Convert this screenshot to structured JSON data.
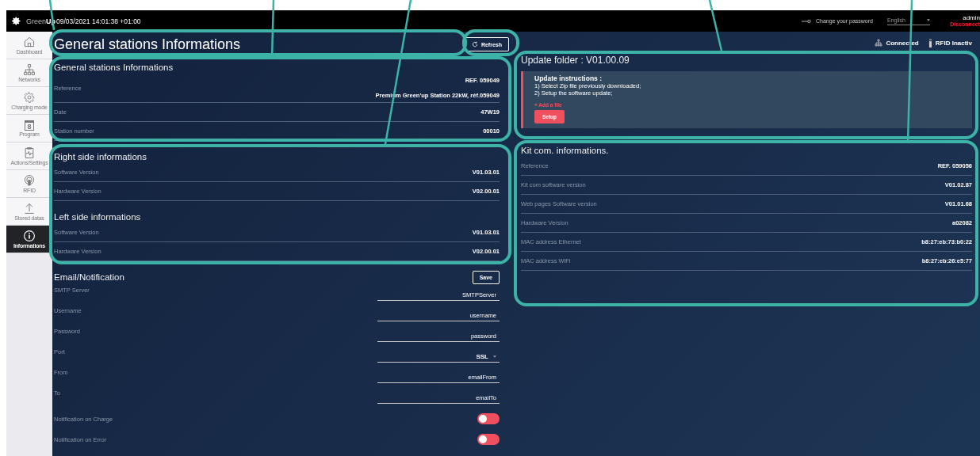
{
  "top_bar": {
    "brand_light": "Green",
    "brand_bold": "Up",
    "datetime": "09/03/2021 14:01:38 +01:00",
    "change_password": "Change your password",
    "language": "English",
    "user": "admin",
    "logout": "Disconnect"
  },
  "sidebar": {
    "items": [
      {
        "label": "Dashboard",
        "selected": false
      },
      {
        "label": "Networks",
        "selected": false
      },
      {
        "label": "Charging mode",
        "selected": false
      },
      {
        "label": "Program",
        "icon_digit": "8",
        "selected": false
      },
      {
        "label": "Actions/Settings",
        "selected": false
      },
      {
        "label": "RFID",
        "selected": false
      },
      {
        "label": "Stored datas",
        "selected": false
      },
      {
        "label": "Informations",
        "selected": true
      }
    ]
  },
  "page": {
    "title": "General stations Informations",
    "refresh_button": "Refresh"
  },
  "status": {
    "connection": "Connected",
    "rfid": "RFID Inactiv"
  },
  "general": {
    "title": "General stations Informations",
    "rows": [
      {
        "label": "Reference",
        "values": [
          "REF. 059049",
          "Premium Green'up Station 22kW, réf.059049"
        ]
      },
      {
        "label": "Date",
        "values": [
          "47W19"
        ]
      },
      {
        "label": "Station number",
        "values": [
          "00010"
        ]
      }
    ]
  },
  "sides": [
    {
      "title": "Right side informations",
      "rows": [
        {
          "label": "Software Version",
          "value": "V01.03.01"
        },
        {
          "label": "Hardware Version",
          "value": "V02.00.01"
        }
      ]
    },
    {
      "title": "Left side informations",
      "rows": [
        {
          "label": "Software Version",
          "value": "V01.03.01"
        },
        {
          "label": "Hardware Version",
          "value": "V02.00.01"
        }
      ]
    }
  ],
  "email": {
    "title": "Email/Notification",
    "save_button": "Save",
    "fields": [
      {
        "label": "SMTP Server",
        "value": "SMTPServer",
        "kind": "text"
      },
      {
        "label": "Username",
        "value": "username",
        "kind": "text"
      },
      {
        "label": "Password",
        "value": "password",
        "kind": "text"
      },
      {
        "label": "Port",
        "value": "SSL",
        "kind": "select"
      },
      {
        "label": "From",
        "value": "emailFrom",
        "kind": "text"
      },
      {
        "label": "To",
        "value": "emailTo",
        "kind": "text"
      }
    ],
    "toggles": [
      {
        "label": "Notification on Charge",
        "on": false
      },
      {
        "label": "Notification on Error",
        "on": false
      }
    ]
  },
  "update": {
    "title": "Update folder : V01.00.09",
    "instructions_title": "Update instructions :",
    "steps": [
      "1) Select Zip file previously downloaded;",
      "2) Setup the software update;"
    ],
    "add_file": "+ Add a file",
    "setup_button": "Setup"
  },
  "kit_com": {
    "title": "Kit com. informations.",
    "rows": [
      {
        "label": "Reference",
        "value": "REF. 059056"
      },
      {
        "label": "Kit com software version",
        "value": "V01.02.87"
      },
      {
        "label": "Web pages Software version",
        "value": "V01.01.68"
      },
      {
        "label": "Hardware Version",
        "value": "a02082"
      },
      {
        "label": "MAC address Ethernet",
        "value": "b8:27:eb:73:b0:22"
      },
      {
        "label": "MAC address WiFi",
        "value": "b8:27:eb:26:e5:77"
      }
    ]
  }
}
